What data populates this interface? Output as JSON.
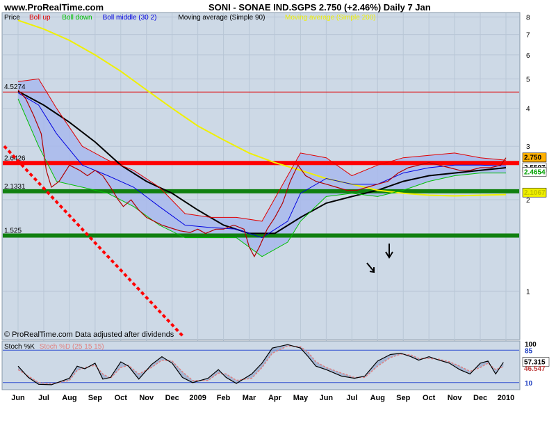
{
  "header": {
    "site": "www.ProRealTime.com",
    "symbol_line": "SONI - SONAE IND.SGPS    2.750 (+2.46%)    Daily  7 Jan"
  },
  "legend": [
    {
      "label": "Price",
      "color": "#000000"
    },
    {
      "label": "Boll up",
      "color": "#e00000"
    },
    {
      "label": "Boll down",
      "color": "#00c000"
    },
    {
      "label": "Boll middle (30 2)",
      "color": "#0000e0"
    },
    {
      "label": "Moving average (Simple 90)",
      "color": "#000000"
    },
    {
      "label": "Moving average (Simple 200)",
      "color": "#f0f000"
    }
  ],
  "footer_note": "© ProRealTime.com  Data adjusted after dividends",
  "stoch": {
    "legend": [
      {
        "label": "Stoch %K",
        "color": "#000000"
      },
      {
        "label": "Stoch %D (25 15 15)",
        "color": "#e08080"
      }
    ],
    "axis_labels": [
      "100",
      "85",
      "10"
    ],
    "readouts": {
      "k": "57.315",
      "d": "46.547"
    }
  },
  "colors": {
    "panel_bg": "#cdd9e6",
    "band_fill": "#a8b8ec",
    "support_green": "#108010",
    "resistance_red": "#ff0000"
  },
  "chart_data": [
    {
      "type": "line",
      "title": "SONI - SONAE IND.SGPS",
      "x": [
        "Jun",
        "Jul",
        "Aug",
        "Sep",
        "Oct",
        "Nov",
        "Dec",
        "2009",
        "Feb",
        "Mar",
        "Apr",
        "May",
        "Jun",
        "Jul",
        "Aug",
        "Sep",
        "Oct",
        "Nov",
        "Dec",
        "2010"
      ],
      "ylim": [
        0.7,
        8.1
      ],
      "yticks": [
        1,
        2,
        3,
        4,
        5,
        6,
        7,
        8
      ],
      "scale": "log",
      "price_series": [
        [
          0,
          4.6
        ],
        [
          0.3,
          4.3
        ],
        [
          0.6,
          3.8
        ],
        [
          0.9,
          3.3
        ],
        [
          1.1,
          2.5
        ],
        [
          1.3,
          2.2
        ],
        [
          1.6,
          2.3
        ],
        [
          2.0,
          2.6
        ],
        [
          2.4,
          2.5
        ],
        [
          2.7,
          2.4
        ],
        [
          3.0,
          2.5
        ],
        [
          3.3,
          2.4
        ],
        [
          3.6,
          2.2
        ],
        [
          3.9,
          2.0
        ],
        [
          4.1,
          1.9
        ],
        [
          4.4,
          2.0
        ],
        [
          4.7,
          1.85
        ],
        [
          5.0,
          1.75
        ],
        [
          5.3,
          1.7
        ],
        [
          5.6,
          1.65
        ],
        [
          5.9,
          1.62
        ],
        [
          6.3,
          1.58
        ],
        [
          6.7,
          1.56
        ],
        [
          7.0,
          1.6
        ],
        [
          7.3,
          1.55
        ],
        [
          7.7,
          1.6
        ],
        [
          8.0,
          1.6
        ],
        [
          8.4,
          1.65
        ],
        [
          8.8,
          1.6
        ],
        [
          9.0,
          1.4
        ],
        [
          9.2,
          1.3
        ],
        [
          9.4,
          1.4
        ],
        [
          9.7,
          1.6
        ],
        [
          10.0,
          1.75
        ],
        [
          10.3,
          1.95
        ],
        [
          10.6,
          2.3
        ],
        [
          10.9,
          2.6
        ],
        [
          11.2,
          2.4
        ],
        [
          11.6,
          2.3
        ],
        [
          12.0,
          2.25
        ],
        [
          12.4,
          2.2
        ],
        [
          12.8,
          2.15
        ],
        [
          13.2,
          2.15
        ],
        [
          13.6,
          2.2
        ],
        [
          14.0,
          2.25
        ],
        [
          14.4,
          2.3
        ],
        [
          14.8,
          2.45
        ],
        [
          15.2,
          2.55
        ],
        [
          15.6,
          2.6
        ],
        [
          16.0,
          2.65
        ],
        [
          16.4,
          2.6
        ],
        [
          16.8,
          2.55
        ],
        [
          17.2,
          2.5
        ],
        [
          17.6,
          2.5
        ],
        [
          18.0,
          2.55
        ],
        [
          18.4,
          2.55
        ],
        [
          18.8,
          2.6
        ],
        [
          19.0,
          2.75
        ]
      ],
      "series": [
        {
          "name": "Moving average (Simple 90)",
          "color": "#000000",
          "points": [
            [
              0,
              4.55
            ],
            [
              1,
              4.1
            ],
            [
              2,
              3.6
            ],
            [
              3,
              3.1
            ],
            [
              4,
              2.6
            ],
            [
              5,
              2.3
            ],
            [
              6,
              2.1
            ],
            [
              7,
              1.85
            ],
            [
              8,
              1.65
            ],
            [
              9,
              1.55
            ],
            [
              10,
              1.55
            ],
            [
              11,
              1.75
            ],
            [
              12,
              1.95
            ],
            [
              13,
              2.05
            ],
            [
              14,
              2.15
            ],
            [
              15,
              2.3
            ],
            [
              16,
              2.4
            ],
            [
              17,
              2.45
            ],
            [
              18,
              2.5
            ],
            [
              19,
              2.55
            ]
          ]
        },
        {
          "name": "Moving average (Simple 200)",
          "color": "#f0f000",
          "points": [
            [
              0,
              7.8
            ],
            [
              1,
              7.3
            ],
            [
              2,
              6.7
            ],
            [
              3,
              6.0
            ],
            [
              4,
              5.3
            ],
            [
              5,
              4.6
            ],
            [
              6,
              4.0
            ],
            [
              7,
              3.5
            ],
            [
              8,
              3.15
            ],
            [
              9,
              2.85
            ],
            [
              10,
              2.65
            ],
            [
              11,
              2.5
            ],
            [
              12,
              2.35
            ],
            [
              13,
              2.25
            ],
            [
              14,
              2.15
            ],
            [
              15,
              2.1
            ],
            [
              16,
              2.07
            ],
            [
              17,
              2.06
            ],
            [
              18,
              2.07
            ],
            [
              19,
              2.08
            ]
          ]
        },
        {
          "name": "Boll up",
          "color": "#e00000",
          "points": [
            [
              0,
              4.9
            ],
            [
              0.8,
              5.0
            ],
            [
              1.5,
              4.0
            ],
            [
              2.5,
              3.0
            ],
            [
              3.5,
              2.7
            ],
            [
              4.5,
              2.5
            ],
            [
              5.5,
              2.2
            ],
            [
              6.5,
              1.8
            ],
            [
              7.5,
              1.75
            ],
            [
              8.5,
              1.75
            ],
            [
              9.5,
              1.7
            ],
            [
              10.5,
              2.4
            ],
            [
              11,
              2.85
            ],
            [
              12,
              2.75
            ],
            [
              13,
              2.4
            ],
            [
              14,
              2.6
            ],
            [
              15,
              2.75
            ],
            [
              16,
              2.8
            ],
            [
              17,
              2.85
            ],
            [
              18,
              2.75
            ],
            [
              19,
              2.7
            ]
          ]
        },
        {
          "name": "Boll middle (30 2)",
          "color": "#0000e0",
          "points": [
            [
              0,
              4.5
            ],
            [
              0.8,
              4.1
            ],
            [
              1.5,
              3.3
            ],
            [
              2.5,
              2.6
            ],
            [
              3.5,
              2.4
            ],
            [
              4.5,
              2.2
            ],
            [
              5.5,
              1.9
            ],
            [
              6.5,
              1.65
            ],
            [
              7.5,
              1.62
            ],
            [
              8.5,
              1.6
            ],
            [
              9.5,
              1.5
            ],
            [
              10.5,
              1.7
            ],
            [
              11,
              2.1
            ],
            [
              12,
              2.35
            ],
            [
              13,
              2.25
            ],
            [
              14,
              2.25
            ],
            [
              15,
              2.45
            ],
            [
              16,
              2.55
            ],
            [
              17,
              2.6
            ],
            [
              18,
              2.6
            ],
            [
              19,
              2.58
            ]
          ]
        },
        {
          "name": "Boll down",
          "color": "#00c000",
          "points": [
            [
              0,
              4.3
            ],
            [
              0.8,
              3.0
            ],
            [
              1.5,
              2.3
            ],
            [
              2.5,
              2.2
            ],
            [
              3.5,
              2.1
            ],
            [
              4.5,
              1.9
            ],
            [
              5.5,
              1.65
            ],
            [
              6.5,
              1.5
            ],
            [
              7.5,
              1.5
            ],
            [
              8.5,
              1.5
            ],
            [
              9.5,
              1.3
            ],
            [
              10.5,
              1.45
            ],
            [
              11,
              1.7
            ],
            [
              12,
              2.05
            ],
            [
              13,
              2.1
            ],
            [
              14,
              2.05
            ],
            [
              15,
              2.15
            ],
            [
              16,
              2.3
            ],
            [
              17,
              2.4
            ],
            [
              18,
              2.45
            ],
            [
              19,
              2.45
            ]
          ]
        }
      ],
      "levels": [
        {
          "label": "2.6426",
          "value": 2.6426,
          "color": "#ff0000"
        },
        {
          "label": "2.1331",
          "value": 2.1331,
          "color": "#108010"
        },
        {
          "label": "1.525",
          "value": 1.525,
          "color": "#108010"
        },
        {
          "label": "4.5274",
          "value": 4.5274,
          "color": "#e00000"
        }
      ],
      "price_tags": [
        {
          "label": "2.750",
          "value": 2.75,
          "bg": "#ffb000",
          "fg": "#000000"
        },
        {
          "label": "2.5507",
          "value": 2.5507,
          "bg": "#ffffff",
          "fg": "#000000"
        },
        {
          "label": "2.4654",
          "value": 2.4654,
          "bg": "#ffffff",
          "fg": "#00a000"
        },
        {
          "label": "2.1067",
          "value": 2.1067,
          "bg": "#f0f000",
          "fg": "#c0c000"
        }
      ]
    },
    {
      "type": "line",
      "title": "Stoch %K Stoch %D (25 15 15)",
      "ylim": [
        0,
        100
      ],
      "yticks": [
        10,
        85,
        100
      ],
      "series": [
        {
          "name": "Stoch %K",
          "color": "#000000",
          "points": [
            [
              0,
              48
            ],
            [
              0.4,
              22
            ],
            [
              0.8,
              6
            ],
            [
              1.3,
              5
            ],
            [
              2.0,
              20
            ],
            [
              2.3,
              48
            ],
            [
              2.6,
              42
            ],
            [
              3.0,
              55
            ],
            [
              3.3,
              18
            ],
            [
              3.6,
              22
            ],
            [
              4.0,
              58
            ],
            [
              4.3,
              48
            ],
            [
              4.7,
              18
            ],
            [
              5.2,
              52
            ],
            [
              5.6,
              70
            ],
            [
              6.0,
              55
            ],
            [
              6.4,
              22
            ],
            [
              6.8,
              10
            ],
            [
              7.4,
              20
            ],
            [
              7.8,
              40
            ],
            [
              8.1,
              22
            ],
            [
              8.5,
              8
            ],
            [
              9.1,
              30
            ],
            [
              9.5,
              55
            ],
            [
              9.9,
              90
            ],
            [
              10.5,
              98
            ],
            [
              11.0,
              90
            ],
            [
              11.3,
              70
            ],
            [
              11.6,
              48
            ],
            [
              12.0,
              40
            ],
            [
              12.6,
              25
            ],
            [
              13.1,
              20
            ],
            [
              13.5,
              25
            ],
            [
              14.0,
              60
            ],
            [
              14.5,
              75
            ],
            [
              14.9,
              78
            ],
            [
              15.3,
              70
            ],
            [
              15.6,
              62
            ],
            [
              16.0,
              70
            ],
            [
              16.4,
              62
            ],
            [
              16.8,
              55
            ],
            [
              17.2,
              40
            ],
            [
              17.6,
              30
            ],
            [
              18.0,
              55
            ],
            [
              18.3,
              60
            ],
            [
              18.6,
              30
            ],
            [
              18.9,
              57
            ]
          ]
        },
        {
          "name": "Stoch %D (25 15 15)",
          "color": "#e08080",
          "points": [
            [
              0,
              40
            ],
            [
              0.4,
              25
            ],
            [
              0.8,
              10
            ],
            [
              1.3,
              7
            ],
            [
              2.0,
              15
            ],
            [
              2.3,
              38
            ],
            [
              2.6,
              45
            ],
            [
              3.0,
              50
            ],
            [
              3.3,
              30
            ],
            [
              3.6,
              20
            ],
            [
              4.0,
              45
            ],
            [
              4.3,
              50
            ],
            [
              4.7,
              30
            ],
            [
              5.2,
              45
            ],
            [
              5.6,
              62
            ],
            [
              6.0,
              60
            ],
            [
              6.4,
              35
            ],
            [
              6.8,
              15
            ],
            [
              7.4,
              15
            ],
            [
              7.8,
              32
            ],
            [
              8.1,
              30
            ],
            [
              8.5,
              15
            ],
            [
              9.1,
              20
            ],
            [
              9.5,
              45
            ],
            [
              9.9,
              78
            ],
            [
              10.5,
              95
            ],
            [
              11.0,
              93
            ],
            [
              11.3,
              80
            ],
            [
              11.6,
              58
            ],
            [
              12.0,
              45
            ],
            [
              12.6,
              32
            ],
            [
              13.1,
              22
            ],
            [
              13.5,
              22
            ],
            [
              14.0,
              48
            ],
            [
              14.5,
              68
            ],
            [
              14.9,
              76
            ],
            [
              15.3,
              74
            ],
            [
              15.6,
              66
            ],
            [
              16.0,
              66
            ],
            [
              16.4,
              64
            ],
            [
              16.8,
              58
            ],
            [
              17.2,
              48
            ],
            [
              17.6,
              36
            ],
            [
              18.0,
              45
            ],
            [
              18.3,
              55
            ],
            [
              18.6,
              40
            ],
            [
              18.9,
              47
            ]
          ]
        }
      ]
    }
  ]
}
